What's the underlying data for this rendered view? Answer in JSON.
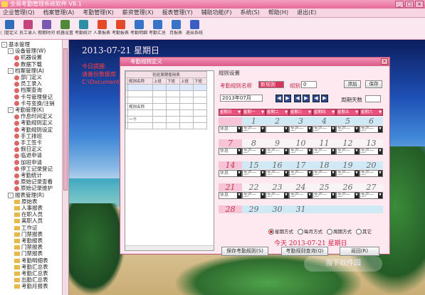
{
  "app": {
    "title": "全易考勤管理系统软件 V8.1"
  },
  "window_buttons": [
    "_",
    "□",
    "×"
  ],
  "menu": [
    "企业管理(Q)",
    "档案管理(A)",
    "考勤管理(K)",
    "薪资管理(X)",
    "报表管理(Y)",
    "辅助功能(F)",
    "系统(S)",
    "帮助(H)",
    "退出(E)"
  ],
  "toolbar": [
    {
      "label": "门管定义",
      "icon": "door-icon",
      "color": "#2f6db8"
    },
    {
      "label": "员工录入",
      "icon": "user-add-icon",
      "color": "#c3457a"
    },
    {
      "label": "假期时间",
      "icon": "calendar-icon",
      "color": "#7a59b3"
    },
    {
      "label": "机器设置",
      "icon": "machine-icon",
      "color": "#4e8a3a"
    },
    {
      "label": "考勤统计",
      "icon": "stats-icon",
      "color": "#2d8fa6"
    },
    {
      "label": "人事报表",
      "icon": "report-a-icon",
      "color": "#e24a2a"
    },
    {
      "label": "考勤报表",
      "icon": "report-a2-icon",
      "color": "#e24a2a"
    },
    {
      "label": "考勤明细",
      "icon": "detail-icon",
      "color": "#3773c6"
    },
    {
      "label": "考勤汇总",
      "icon": "summary-icon",
      "color": "#3773c6"
    },
    {
      "label": "月报表",
      "icon": "monthly-icon",
      "color": "#3773c6"
    },
    {
      "label": "退出系统",
      "icon": "exit-icon",
      "color": "#3a5ec2"
    }
  ],
  "tree": [
    {
      "label": "基本管理",
      "level": 0,
      "kind": "box",
      "sign": "-"
    },
    {
      "label": "设备管理(W)",
      "level": 1,
      "kind": "box",
      "sign": "-"
    },
    {
      "label": "机器设置",
      "level": 2,
      "kind": "dot"
    },
    {
      "label": "数据下载",
      "level": 2,
      "kind": "dot"
    },
    {
      "label": "档案管理(A)",
      "level": 1,
      "kind": "box",
      "sign": "-"
    },
    {
      "label": "部门定义",
      "level": 2,
      "kind": "dot"
    },
    {
      "label": "员工录入",
      "level": 2,
      "kind": "dot"
    },
    {
      "label": "档案查询",
      "level": 2,
      "kind": "dot"
    },
    {
      "label": "卡号管理登记",
      "level": 2,
      "kind": "dot"
    },
    {
      "label": "卡号变换/注销",
      "level": 2,
      "kind": "dot"
    },
    {
      "label": "考勤管理(K)",
      "level": 1,
      "kind": "box",
      "sign": "-"
    },
    {
      "label": "作息时间定义",
      "level": 2,
      "kind": "dot"
    },
    {
      "label": "考勤规则定义",
      "level": 2,
      "kind": "dot"
    },
    {
      "label": "考勤规则设定",
      "level": 2,
      "kind": "dot"
    },
    {
      "label": "手工排班",
      "level": 2,
      "kind": "dot"
    },
    {
      "label": "手工签卡",
      "level": 2,
      "kind": "dot"
    },
    {
      "label": "假日定义",
      "level": 2,
      "kind": "dot"
    },
    {
      "label": "临退申请",
      "level": 2,
      "kind": "dot"
    },
    {
      "label": "加班申请",
      "level": 2,
      "kind": "dot"
    },
    {
      "label": "停工记录登记",
      "level": 2,
      "kind": "dot"
    },
    {
      "label": "考勤统计",
      "level": 2,
      "kind": "dot"
    },
    {
      "label": "原始记录查看",
      "level": 2,
      "kind": "dot"
    },
    {
      "label": "原始记录维护",
      "level": 2,
      "kind": "dot"
    },
    {
      "label": "报表管理(R)",
      "level": 1,
      "kind": "box",
      "sign": "-"
    },
    {
      "label": "原始表",
      "level": 2,
      "kind": "folder"
    },
    {
      "label": "人事报表",
      "level": 2,
      "kind": "folder"
    },
    {
      "label": "在职人员",
      "level": 2,
      "kind": "folder"
    },
    {
      "label": "离职人员",
      "level": 2,
      "kind": "folder"
    },
    {
      "label": "工作证",
      "level": 2,
      "kind": "folder"
    },
    {
      "label": "门禁报表",
      "level": 2,
      "kind": "folder"
    },
    {
      "label": "考勤报表",
      "level": 2,
      "kind": "folder"
    },
    {
      "label": "门禁报表",
      "level": 2,
      "kind": "folder"
    },
    {
      "label": "门禁报表",
      "level": 2,
      "kind": "folder"
    },
    {
      "label": "考勤明细表",
      "level": 2,
      "kind": "folder"
    },
    {
      "label": "考勤汇总表",
      "level": 2,
      "kind": "folder"
    },
    {
      "label": "考勤汇总表",
      "level": 2,
      "kind": "folder"
    },
    {
      "label": "出勤汇总表",
      "level": 2,
      "kind": "folder"
    },
    {
      "label": "考勤月报表",
      "level": 2,
      "kind": "folder"
    }
  ],
  "desktop": {
    "date": "2013-07-21 星期日",
    "notes": [
      "今日提醒:",
      "请备份数据库",
      "C:\\Documents"
    ],
    "watermark": "当下软件园"
  },
  "dialog": {
    "title": "考勤规则定义",
    "close": "×",
    "list": {
      "group_title": "轮班周期使用表",
      "headers": [
        "规则名称",
        "上班",
        "下班",
        "上班",
        "下班"
      ],
      "rows": [
        [
          "",
          "",
          "",
          "",
          ""
        ],
        [
          "",
          "",
          "",
          "",
          ""
        ],
        [
          "",
          "",
          "",
          "",
          ""
        ],
        [
          "规则名称",
          "",
          "",
          "",
          ""
        ],
        [
          "",
          "",
          "",
          "",
          ""
        ],
        [
          "一个",
          "",
          "",
          "",
          ""
        ],
        [
          "",
          "",
          "",
          "",
          ""
        ]
      ]
    },
    "group_label": "规则设置",
    "rule_name_label": "考勤规则名称",
    "rule_name_value": "新规则",
    "group_no_label": "组别",
    "group_no_value": "0",
    "add_button": "添加",
    "save_button": "保存",
    "month_value": "2013年07月",
    "nav": [
      "◀",
      "▶",
      "◀",
      "▶",
      "◀",
      "▶"
    ],
    "cycle_days_label": "周期天数",
    "cycle_days_value": "",
    "weekdays": [
      "星期日",
      "星期一",
      "星期二",
      "星期三",
      "星期四",
      "星期五",
      "星期六"
    ],
    "rows": [
      {
        "days": [
          "",
          "1",
          "2",
          "3",
          "4",
          "5",
          "6"
        ],
        "shifts": [
          "休息",
          "生产一",
          "",
          "生产一",
          "生产一",
          "生产一",
          "生产一"
        ]
      },
      {
        "days": [
          "7",
          "8",
          "9",
          "10",
          "11",
          "12",
          "13"
        ],
        "shifts": [
          "休息",
          "生产一",
          "生产一",
          "生产一",
          "生产一",
          "生产一",
          "生产一"
        ]
      },
      {
        "days": [
          "14",
          "15",
          "16",
          "17",
          "18",
          "19",
          "20"
        ],
        "shifts": [
          "休息",
          "生产一",
          "生产一",
          "生产一",
          "生产一",
          "生产一",
          "生产一"
        ]
      },
      {
        "days": [
          "21",
          "22",
          "23",
          "24",
          "25",
          "26",
          "27"
        ],
        "shifts": [
          "休息",
          "生产一",
          "生产一",
          "生产一",
          "生产一",
          "生产一",
          "生产一"
        ]
      },
      {
        "days": [
          "28",
          "29",
          "30",
          "31",
          "",
          "",
          ""
        ],
        "shifts": [
          "",
          "",
          "",
          "",
          "",
          "",
          ""
        ]
      }
    ],
    "radios": [
      {
        "label": "星期方式",
        "on": true
      },
      {
        "label": "每月方式",
        "on": false
      },
      {
        "label": "周期方式",
        "on": false
      },
      {
        "label": "其它",
        "on": false
      }
    ],
    "today": "今天 2013-07-21 星期日",
    "buttons": [
      "保存考勤规则(S)",
      "考勤规则查询(Q)",
      "返回(R)"
    ]
  }
}
